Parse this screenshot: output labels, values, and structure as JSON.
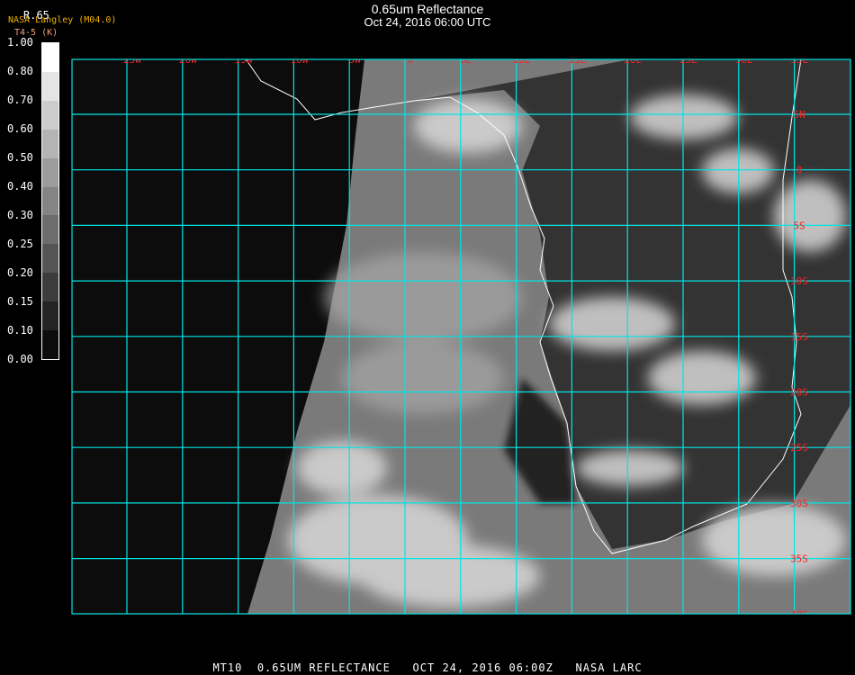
{
  "header": {
    "title": "0.65um Reflectance",
    "datetime": "Oct 24, 2016 06:00 UTC"
  },
  "legend": {
    "title": "R.65",
    "provider": "NASA Langley (M04.0)",
    "subtitle": "T4-5 (K)",
    "labels": [
      "1.00",
      "0.80",
      "0.70",
      "0.60",
      "0.50",
      "0.40",
      "0.30",
      "0.25",
      "0.20",
      "0.15",
      "0.10",
      "0.00"
    ],
    "colors": [
      "#ffffff",
      "#e4e4e4",
      "#cccccc",
      "#b4b4b4",
      "#9c9c9c",
      "#848484",
      "#6c6c6c",
      "#545454",
      "#3c3c3c",
      "#242424",
      "#0c0c0c"
    ]
  },
  "map": {
    "grid_color": "#00e5e5",
    "label_color": "#ff2020",
    "longitudes": [
      "25W",
      "20W",
      "15W",
      "10W",
      "5W",
      "0",
      "5E",
      "10E",
      "15E",
      "20E",
      "25E",
      "30E",
      "35E"
    ],
    "latitudes": [
      "5N",
      "0",
      "5S",
      "10S",
      "15S",
      "20S",
      "25S",
      "30S",
      "35S",
      "40S"
    ]
  },
  "footer": {
    "sat": "MT10",
    "product": "0.65UM REFLECTANCE",
    "time": "OCT 24, 2016 06:00Z",
    "org": "NASA LARC"
  }
}
